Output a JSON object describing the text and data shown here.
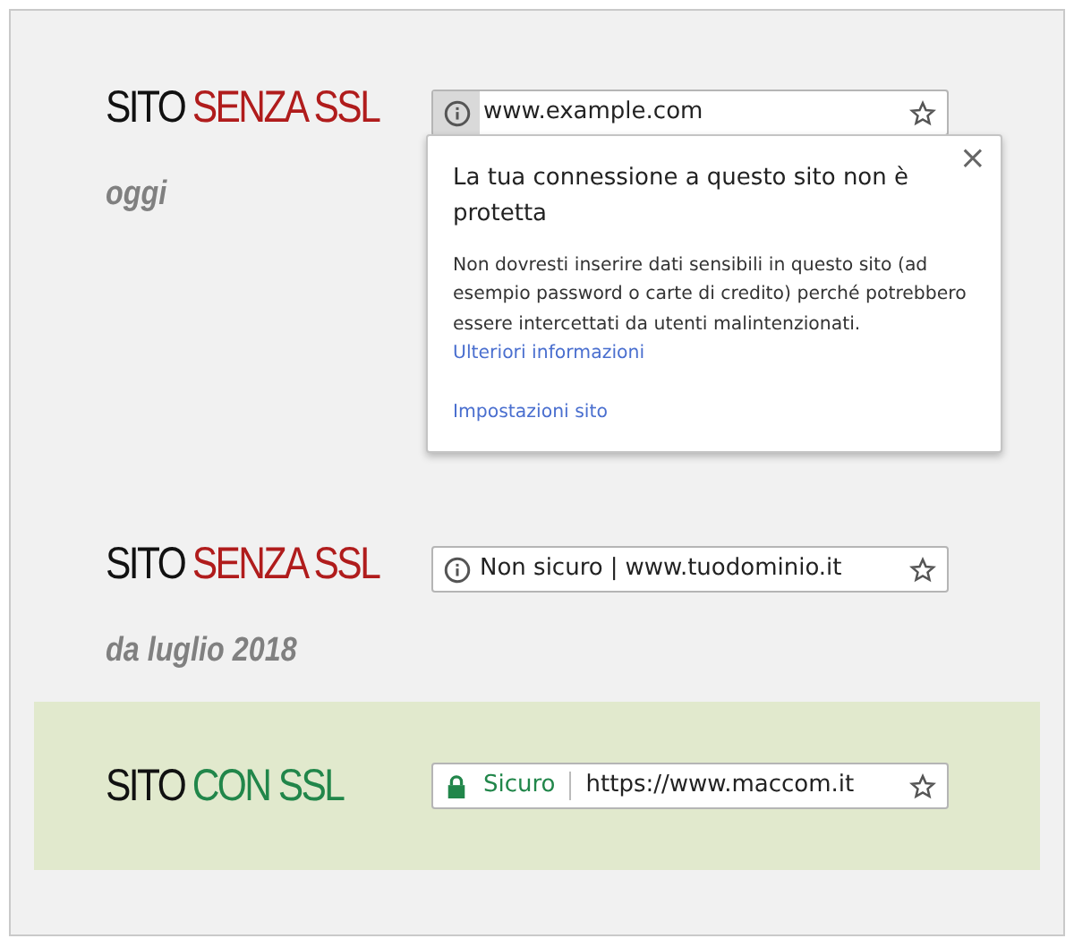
{
  "sections": [
    {
      "title": [
        {
          "text": "SITO",
          "color": "#111111"
        },
        {
          "text": "SENZA SSL",
          "color": "#b01c1c"
        }
      ],
      "subtitle": "oggi",
      "highlighted": false,
      "address_bar": {
        "kind": "info",
        "pressed": true,
        "url": "www.example.com"
      },
      "popup": {
        "title": "La tua connessione a questo sito non è protetta",
        "close": "×",
        "body": "Non dovresti inserire dati sensibili in questo sito (ad esempio password o carte di credito) perché potrebbero essere intercettati da utenti malintenzionati.",
        "link": "Ulteriori informazioni",
        "settings_link": "Impostazioni sito"
      }
    },
    {
      "title": [
        {
          "text": "SITO",
          "color": "#111111"
        },
        {
          "text": "SENZA SSL",
          "color": "#b01c1c"
        }
      ],
      "subtitle": "da luglio 2018",
      "highlighted": false,
      "address_bar": {
        "kind": "info",
        "pressed": false,
        "status": "Non sicuro",
        "separator": "|",
        "url": "www.tuodominio.it"
      }
    },
    {
      "title": [
        {
          "text": "SITO",
          "color": "#111111"
        },
        {
          "text": "CON SSL",
          "color": "#21864a"
        }
      ],
      "highlighted": true,
      "address_bar": {
        "kind": "lock",
        "pressed": false,
        "status": "Sicuro",
        "url": "https://www.maccom.it"
      }
    }
  ]
}
